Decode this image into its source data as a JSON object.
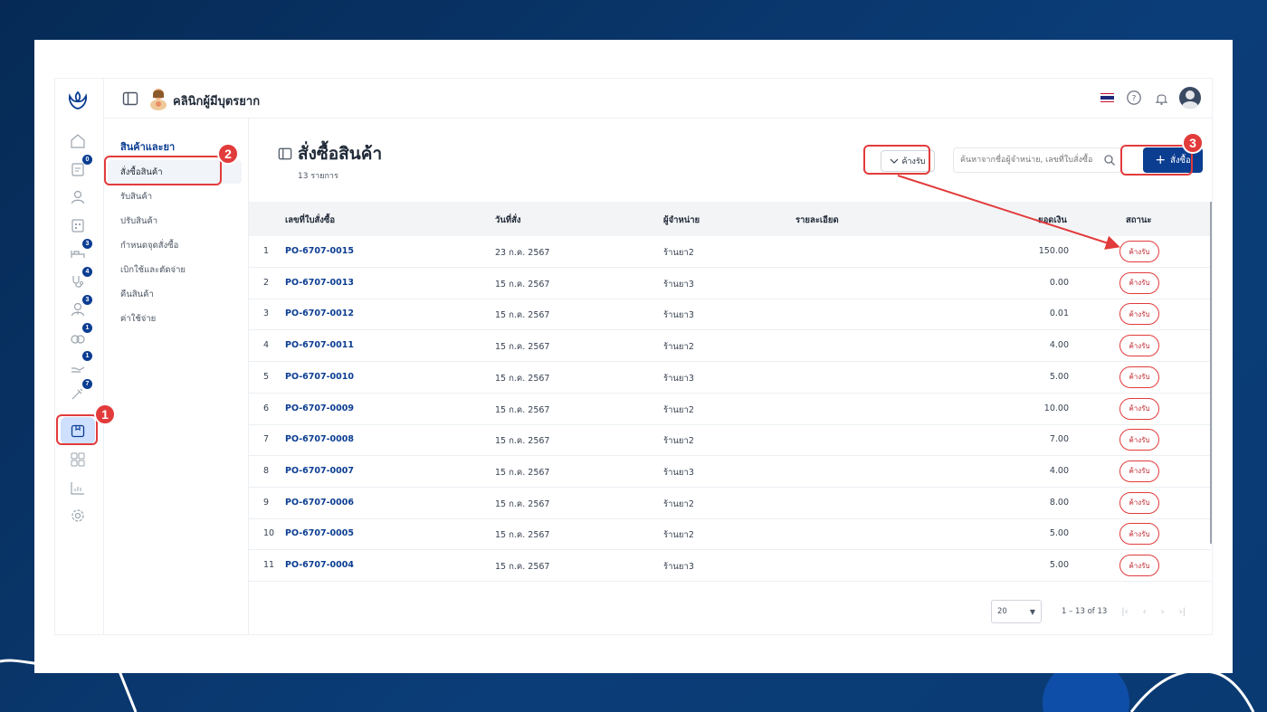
{
  "topbar": {
    "clinic_name": "คลินิกผู้มีบุตรยาก"
  },
  "rail": {
    "badges": [
      "0",
      "3",
      "4",
      "3",
      "1",
      "1",
      "7"
    ]
  },
  "submenu": {
    "heading": "สินค้าและยา",
    "items": [
      "สั่งซื้อสินค้า",
      "รับสินค้า",
      "ปรับสินค้า",
      "กำหนดจุดสั่งซื้อ",
      "เบิกใช้และตัดจ่าย",
      "คืนสินค้า",
      "ค่าใช้จ่าย"
    ]
  },
  "page": {
    "title": "สั่งซื้อสินค้า",
    "count": "13 รายการ",
    "filter_label": "ค้างรับ",
    "search_placeholder": "ค้นหาจากชื่อผู้จำหน่าย, เลขที่ใบสั่งซื้อ",
    "create_label": "สั่งซื้อ"
  },
  "table": {
    "headers": {
      "po": "เลขที่ใบสั่งซื้อ",
      "date": "วันที่สั่ง",
      "supplier": "ผู้จำหน่าย",
      "detail": "รายละเอียด",
      "amount": "ยอดเงิน",
      "status": "สถานะ"
    },
    "rows": [
      {
        "no": "1",
        "po": "PO-6707-0015",
        "date": "23 ก.ค. 2567",
        "supplier": "ร้านยา2",
        "amount": "150.00",
        "status": "ค้างรับ"
      },
      {
        "no": "2",
        "po": "PO-6707-0013",
        "date": "15 ก.ค. 2567",
        "supplier": "ร้านยา3",
        "amount": "0.00",
        "status": "ค้างรับ"
      },
      {
        "no": "3",
        "po": "PO-6707-0012",
        "date": "15 ก.ค. 2567",
        "supplier": "ร้านยา3",
        "amount": "0.01",
        "status": "ค้างรับ"
      },
      {
        "no": "4",
        "po": "PO-6707-0011",
        "date": "15 ก.ค. 2567",
        "supplier": "ร้านยา2",
        "amount": "4.00",
        "status": "ค้างรับ"
      },
      {
        "no": "5",
        "po": "PO-6707-0010",
        "date": "15 ก.ค. 2567",
        "supplier": "ร้านยา3",
        "amount": "5.00",
        "status": "ค้างรับ"
      },
      {
        "no": "6",
        "po": "PO-6707-0009",
        "date": "15 ก.ค. 2567",
        "supplier": "ร้านยา2",
        "amount": "10.00",
        "status": "ค้างรับ"
      },
      {
        "no": "7",
        "po": "PO-6707-0008",
        "date": "15 ก.ค. 2567",
        "supplier": "ร้านยา2",
        "amount": "7.00",
        "status": "ค้างรับ"
      },
      {
        "no": "8",
        "po": "PO-6707-0007",
        "date": "15 ก.ค. 2567",
        "supplier": "ร้านยา3",
        "amount": "4.00",
        "status": "ค้างรับ"
      },
      {
        "no": "9",
        "po": "PO-6707-0006",
        "date": "15 ก.ค. 2567",
        "supplier": "ร้านยา2",
        "amount": "8.00",
        "status": "ค้างรับ"
      },
      {
        "no": "10",
        "po": "PO-6707-0005",
        "date": "15 ก.ค. 2567",
        "supplier": "ร้านยา2",
        "amount": "5.00",
        "status": "ค้างรับ"
      },
      {
        "no": "11",
        "po": "PO-6707-0004",
        "date": "15 ก.ค. 2567",
        "supplier": "ร้านยา3",
        "amount": "5.00",
        "status": "ค้างรับ"
      }
    ]
  },
  "pager": {
    "page_size": "20",
    "range": "1 – 13 of 13"
  },
  "annotations": [
    "1",
    "2",
    "3"
  ],
  "colors": {
    "brand": "#0b3d91",
    "marker": "#e23b3b",
    "background": "#062a55"
  }
}
